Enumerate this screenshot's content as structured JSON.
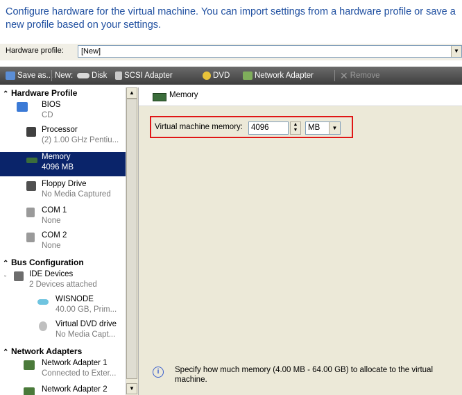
{
  "intro": "Configure hardware for the virtual machine. You can import settings from a hardware profile or save a new profile based on your settings.",
  "hardware_profile": {
    "label": "Hardware profile:",
    "value": "[New]"
  },
  "toolbar": {
    "save_as": "Save as...",
    "new_label": "New:",
    "disk": "Disk",
    "scsi": "SCSI Adapter",
    "dvd": "DVD",
    "network": "Network Adapter",
    "remove": "Remove"
  },
  "sidebar": {
    "sections": {
      "hardware": "Hardware Profile",
      "bus": "Bus Configuration",
      "network": "Network Adapters"
    },
    "items": [
      {
        "title": "BIOS",
        "sub": "CD"
      },
      {
        "title": "Processor",
        "sub": "(2) 1.00 GHz Pentiu..."
      },
      {
        "title": "Memory",
        "sub": "4096 MB"
      },
      {
        "title": "Floppy Drive",
        "sub": "No Media Captured"
      },
      {
        "title": "COM 1",
        "sub": "None"
      },
      {
        "title": "COM 2",
        "sub": "None"
      },
      {
        "title": "IDE Devices",
        "sub": "2 Devices attached"
      },
      {
        "title": "WISNODE",
        "sub": "40.00 GB, Prim..."
      },
      {
        "title": "Virtual DVD drive",
        "sub": "No Media Capt..."
      },
      {
        "title": "Network Adapter 1",
        "sub": "Connected to Exter..."
      },
      {
        "title": "Network Adapter 2",
        "sub": ""
      }
    ]
  },
  "details": {
    "header": "Memory",
    "memory_label": "Virtual machine memory:",
    "memory_value": "4096",
    "unit": "MB",
    "info": "Specify how much memory (4.00 MB - 64.00 GB) to allocate to the virtual machine."
  },
  "colors": {
    "selection": "#0a246a",
    "intro_text": "#1f4fa0",
    "highlight_border": "#e01616"
  }
}
